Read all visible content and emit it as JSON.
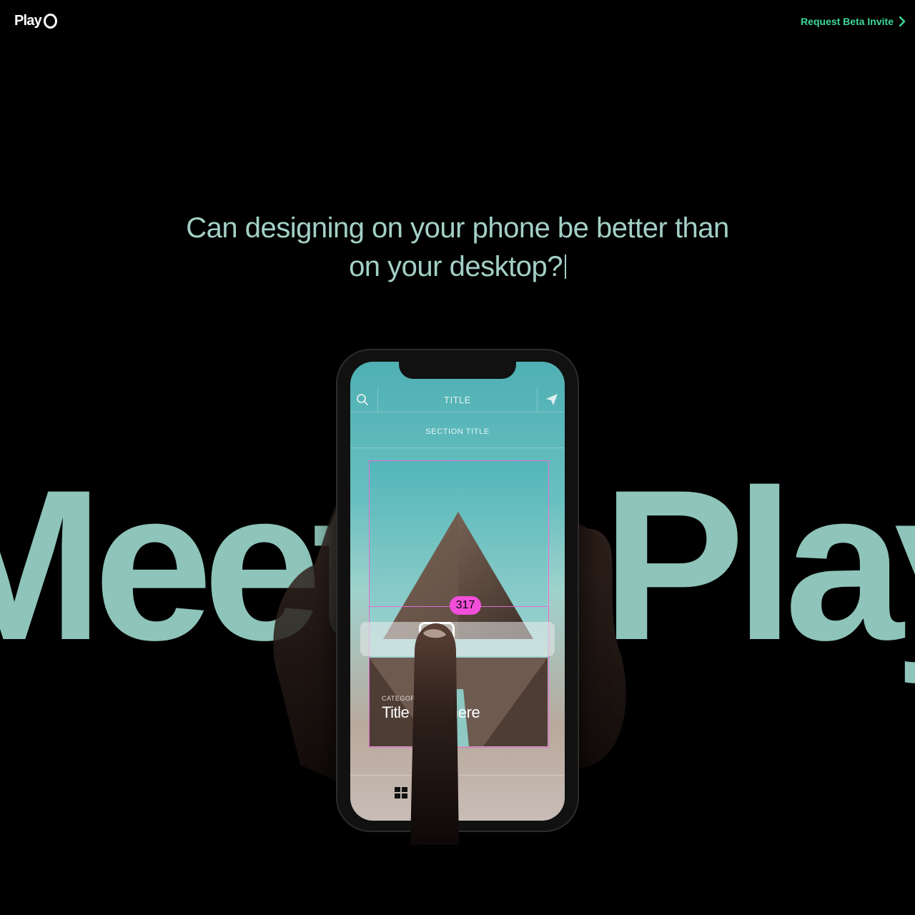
{
  "header": {
    "logo_text": "Play",
    "cta_label": "Request Beta Invite"
  },
  "hero": {
    "headline_line1": "Can designing on your phone be better than",
    "headline_line2": "on your desktop?",
    "big_word_left": "Meet",
    "big_word_right": "Play"
  },
  "phone_ui": {
    "nav_title": "TITLE",
    "section_title": "SECTION TITLE",
    "measure_value": "317",
    "card_category": "CATEGORY",
    "card_title": "Title goes here"
  },
  "colors": {
    "background": "#000000",
    "accent_green": "#3dd99a",
    "headline_mint": "#a3d0c6",
    "big_word_mint": "#8ec4b9",
    "measure_pink": "#f24fd9"
  },
  "icons": [
    "chevron-right-icon",
    "search-icon",
    "send-icon",
    "grid-icon"
  ]
}
